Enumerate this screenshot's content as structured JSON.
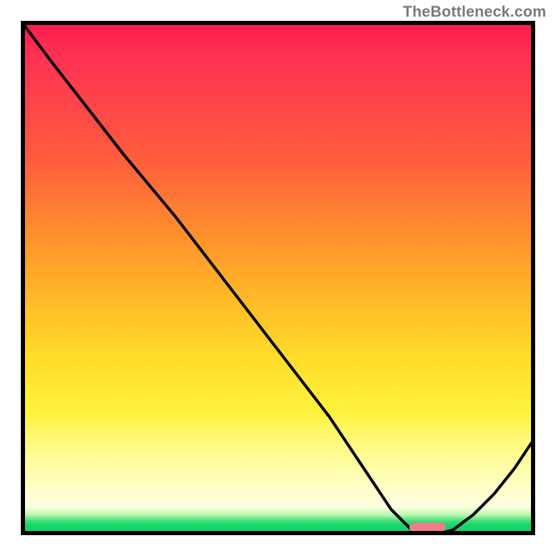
{
  "watermark": "TheBottleneck.com",
  "chart_data": {
    "type": "line",
    "title": "",
    "xlabel": "",
    "ylabel": "",
    "xlim": [
      0,
      100
    ],
    "ylim": [
      0,
      100
    ],
    "grid": false,
    "series": [
      {
        "name": "bottleneck-curve",
        "x": [
          0,
          6,
          20,
          30,
          40,
          50,
          60,
          68,
          72,
          76,
          80,
          84,
          88,
          92,
          96,
          100
        ],
        "values": [
          100,
          92,
          74,
          62,
          49,
          36,
          23,
          11,
          5,
          1,
          0,
          1,
          4,
          8,
          13,
          19
        ]
      }
    ],
    "optimum_marker": {
      "x": 79,
      "y": 1.5
    },
    "background": {
      "type": "heat-gradient",
      "stops": [
        {
          "pos": 0.0,
          "color": "#ff1a4d"
        },
        {
          "pos": 0.07,
          "color": "#ff3154"
        },
        {
          "pos": 0.26,
          "color": "#ff5a3e"
        },
        {
          "pos": 0.4,
          "color": "#ff8a2e"
        },
        {
          "pos": 0.52,
          "color": "#ffb327"
        },
        {
          "pos": 0.66,
          "color": "#ffde2a"
        },
        {
          "pos": 0.76,
          "color": "#fff23e"
        },
        {
          "pos": 0.83,
          "color": "#fffb86"
        },
        {
          "pos": 0.9,
          "color": "#ffffc2"
        },
        {
          "pos": 0.945,
          "color": "#fdffe0"
        },
        {
          "pos": 0.96,
          "color": "#bff7b3"
        },
        {
          "pos": 0.972,
          "color": "#45e07a"
        },
        {
          "pos": 0.98,
          "color": "#16d66b"
        },
        {
          "pos": 1.0,
          "color": "#0fd168"
        }
      ]
    }
  }
}
